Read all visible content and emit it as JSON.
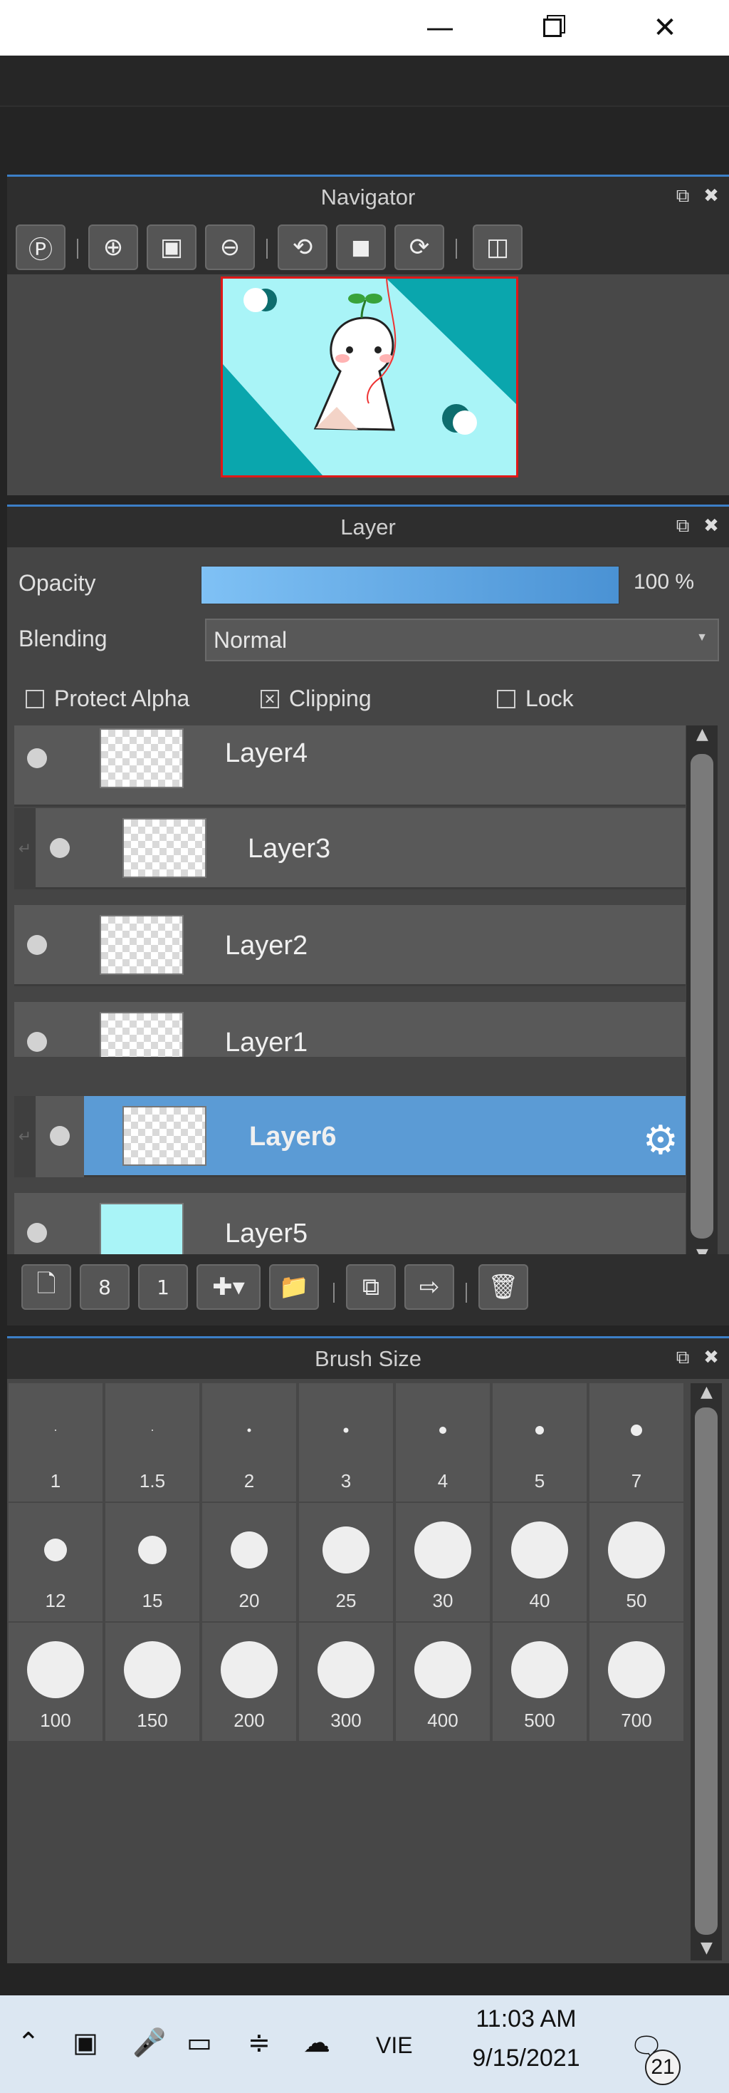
{
  "window": {
    "minimize_icon": "minimize-icon",
    "maximize_icon": "restore-icon",
    "close_icon": "close-icon"
  },
  "navigator": {
    "title": "Navigator",
    "tools": [
      "zoom-actual-icon",
      "zoom-in-icon",
      "fit-icon",
      "zoom-out-icon",
      "rotate-left-icon",
      "fit-screen-icon",
      "rotate-right-icon",
      "flip-icon"
    ]
  },
  "layer": {
    "title": "Layer",
    "opacity_label": "Opacity",
    "opacity_value": "100 %",
    "opacity_fraction": 1.0,
    "blending_label": "Blending",
    "blending_value": "Normal",
    "protect_alpha_label": "Protect Alpha",
    "protect_alpha_checked": false,
    "clipping_label": "Clipping",
    "clipping_checked": true,
    "lock_label": "Lock",
    "lock_checked": false,
    "layers": [
      {
        "name": "Layer4",
        "clipped": false,
        "selected": false
      },
      {
        "name": "Layer3",
        "clipped": true,
        "selected": false
      },
      {
        "name": "Layer2",
        "clipped": false,
        "selected": false
      },
      {
        "name": "Layer1",
        "clipped": false,
        "selected": false
      },
      {
        "name": "Layer6",
        "clipped": true,
        "selected": true
      },
      {
        "name": "Layer5",
        "clipped": false,
        "selected": false
      }
    ],
    "tools": [
      "new-layer-icon",
      "new-8bit-layer-icon",
      "new-1bit-layer-icon",
      "add-layer-dropdown-icon",
      "folder-icon",
      "duplicate-icon",
      "merge-icon",
      "delete-icon"
    ],
    "colors": {
      "selected": "#5b9bd5",
      "row": "#595959"
    }
  },
  "brush": {
    "title": "Brush Size",
    "sizes": [
      "1",
      "1.5",
      "2",
      "3",
      "4",
      "5",
      "7",
      "12",
      "15",
      "20",
      "25",
      "30",
      "40",
      "50",
      "100",
      "150",
      "200",
      "300",
      "400",
      "500",
      "700"
    ]
  },
  "taskbar": {
    "time": "11:03 AM",
    "date": "9/15/2021",
    "language": "VIE",
    "notifications": "21",
    "icons": [
      "chevron-up-icon",
      "meet-now-icon",
      "microphone-icon",
      "battery-icon",
      "wifi-icon",
      "onedrive-icon",
      "notification-icon"
    ]
  }
}
